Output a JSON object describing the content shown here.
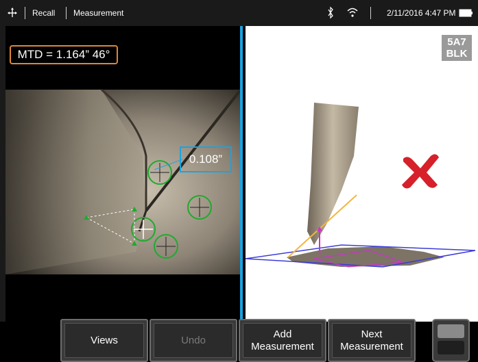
{
  "topbar": {
    "breadcrumb": [
      "Recall",
      "Measurement"
    ],
    "datetime": "2/11/2016 4:47 PM"
  },
  "image_view": {
    "mtd_label": "MTD = 1.164” 46°",
    "measurement_value": "0.108”"
  },
  "point_cloud": {
    "tip_code": "5A7\nBLK",
    "tip_line1": "5A7",
    "tip_line2": "BLK"
  },
  "buttons": {
    "views": "Views",
    "undo": "Undo",
    "add_line1": "Add",
    "add_line2": "Measurement",
    "next_line1": "Next",
    "next_line2": "Measurement"
  },
  "colors": {
    "accent_blue": "#1aa3e0",
    "mtd_orange": "#e0873a",
    "cursor_green": "#1faa2e",
    "invalid_red": "#d6202a",
    "plane_blue": "#3b3bd9",
    "depth_magenta": "#cc33cc",
    "profile_orange": "#f2b640"
  },
  "icons": [
    "move-icon",
    "bluetooth-icon",
    "wifi-icon",
    "battery-icon",
    "invalid-x-icon"
  ]
}
